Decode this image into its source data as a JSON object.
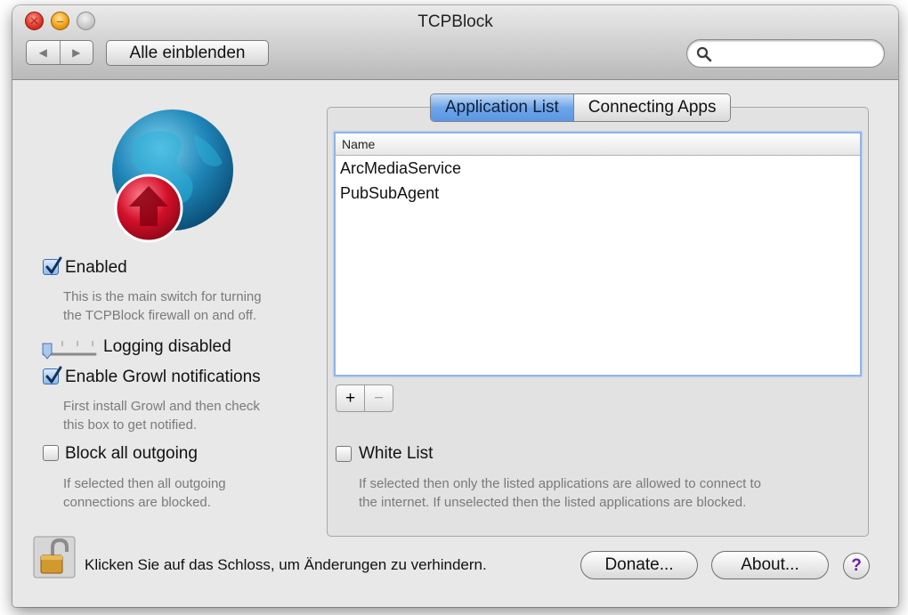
{
  "window": {
    "title": "TCPBlock",
    "traffic_lights": {
      "close_icon": "✕",
      "minimize_icon": "–"
    }
  },
  "toolbar": {
    "back_icon": "◀",
    "forward_icon": "▶",
    "show_all_label": "Alle einblenden",
    "search_placeholder": "",
    "search_value": ""
  },
  "left": {
    "enabled": {
      "label": "Enabled",
      "checked": true,
      "help": [
        "This is the main switch for turning",
        "the TCPBlock firewall on and off."
      ]
    },
    "logging": {
      "label": "Logging disabled",
      "level": 0
    },
    "growl": {
      "label": "Enable Growl notifications",
      "checked": true,
      "help": [
        "First install Growl and then check",
        "this box to get notified."
      ]
    },
    "block_outgoing": {
      "label": "Block all outgoing",
      "checked": false,
      "help": [
        "If selected then all outgoing",
        "connections are blocked."
      ]
    }
  },
  "right": {
    "tabs": [
      {
        "label": "Application List",
        "active": true
      },
      {
        "label": "Connecting Apps",
        "active": false
      }
    ],
    "table": {
      "column": "Name",
      "rows": [
        "ArcMediaService",
        "PubSubAgent"
      ]
    },
    "add_label": "+",
    "remove_label": "−",
    "white_list": {
      "label": "White List",
      "checked": false,
      "help": [
        "If selected then only the listed applications are allowed to connect to",
        "the internet. If unselected then the listed applications are blocked."
      ]
    }
  },
  "footer": {
    "lock_text": "Klicken Sie auf das Schloss, um Änderungen zu verhindern.",
    "donate_label": "Donate...",
    "about_label": "About...",
    "help_label": "?"
  },
  "colors": {
    "accent": "#5a97e6",
    "globe": "#1f86b8",
    "badge": "#d3102a",
    "help_icon": "#6a1fb0"
  }
}
